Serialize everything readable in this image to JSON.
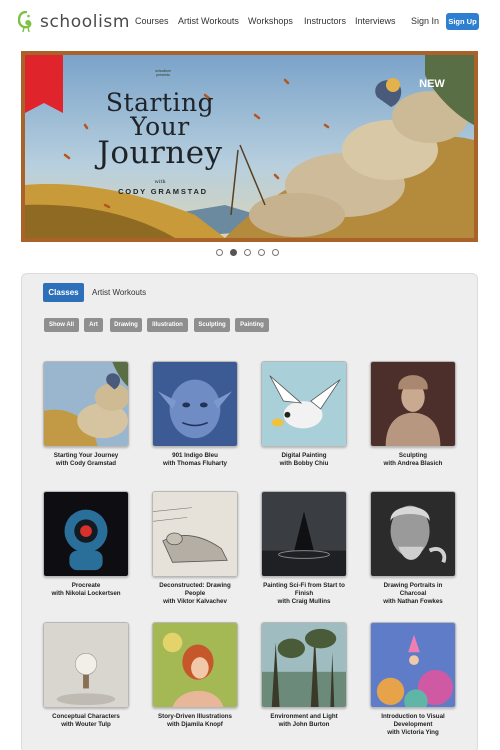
{
  "header": {
    "logo_text": "schoolism",
    "nav": [
      "Courses",
      "Artist Workouts",
      "Workshops",
      "Instructors",
      "Interviews"
    ],
    "signin_label": "Sign In",
    "signup_label": "Sign Up"
  },
  "hero": {
    "brand": "schoolism presents",
    "title_line1": "Starting",
    "title_line2": "Your",
    "title_line3": "Journey",
    "with_label": "with",
    "author": "CODY GRAMSTAD",
    "badge": "NEW",
    "slides": 5,
    "active_slide": 2
  },
  "catalog": {
    "tabs": [
      "Classes",
      "Artist Workouts"
    ],
    "active_tab": "Classes",
    "filters": [
      "Show All",
      "Art",
      "Drawing",
      "Illustration",
      "Sculpting",
      "Painting"
    ],
    "courses": [
      {
        "title": [
          "Starting Your Journey"
        ],
        "instructor": "with Cody Gramstad"
      },
      {
        "title": [
          "901 Indigo Bleu"
        ],
        "instructor": "with Thomas Fluharty"
      },
      {
        "title": [
          "Digital Painting"
        ],
        "instructor": "with Bobby Chiu"
      },
      {
        "title": [
          "Sculpting"
        ],
        "instructor": "with Andrea Blasich"
      },
      {
        "title": [
          "Procreate"
        ],
        "instructor": "with Nikolai Lockertsen"
      },
      {
        "title": [
          "Deconstructed: Drawing",
          "People"
        ],
        "instructor": "with Viktor Kalvachev"
      },
      {
        "title": [
          "Painting Sci-Fi from Start to",
          "Finish"
        ],
        "instructor": "with Craig Mullins"
      },
      {
        "title": [
          "Drawing Portraits in",
          "Charcoal"
        ],
        "instructor": "with Nathan Fowkes"
      },
      {
        "title": [
          "Conceptual Characters"
        ],
        "instructor": "with Wouter Tulp"
      },
      {
        "title": [
          "Story-Driven Illustrations"
        ],
        "instructor": "with Djamila Knopf"
      },
      {
        "title": [
          "Environment and Light"
        ],
        "instructor": "with John Burton"
      },
      {
        "title": [
          "Introduction to Visual",
          "Development"
        ],
        "instructor": "with Victoria Ying"
      }
    ]
  }
}
